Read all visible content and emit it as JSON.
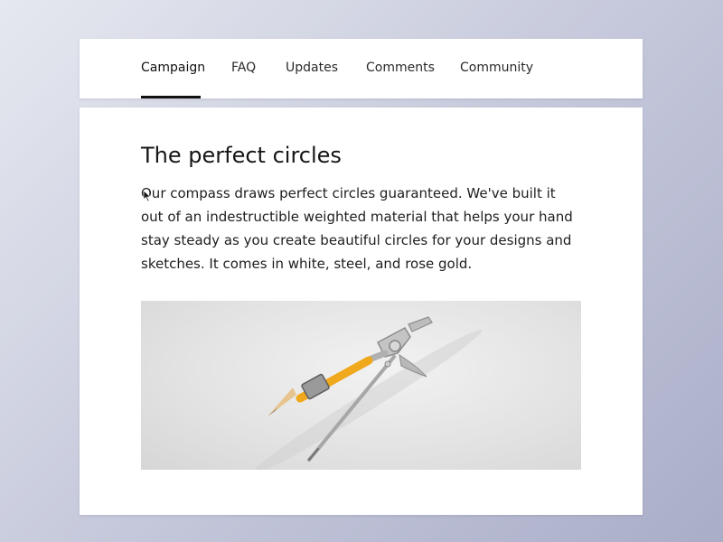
{
  "tabs": [
    {
      "label": "Campaign",
      "active": true
    },
    {
      "label": "FAQ",
      "active": false
    },
    {
      "label": "Updates",
      "active": false
    },
    {
      "label": "Comments",
      "active": false
    },
    {
      "label": "Community",
      "active": false
    }
  ],
  "article": {
    "title": "The perfect circles",
    "body_line1": "Our compass draws perfect circles guaranteed. We've built it",
    "body_line2": "out of an indestructible weighted material that helps your hand",
    "body_line3": "stay steady as you create beautiful circles for your designs and",
    "body_line4": "sketches. It comes in white, steel, and rose gold."
  },
  "image": {
    "subject": "compass-with-pencil"
  },
  "colors": {
    "active_underline": "#111111",
    "pencil": "#f0a81c",
    "metal": "#b9b9b9"
  }
}
